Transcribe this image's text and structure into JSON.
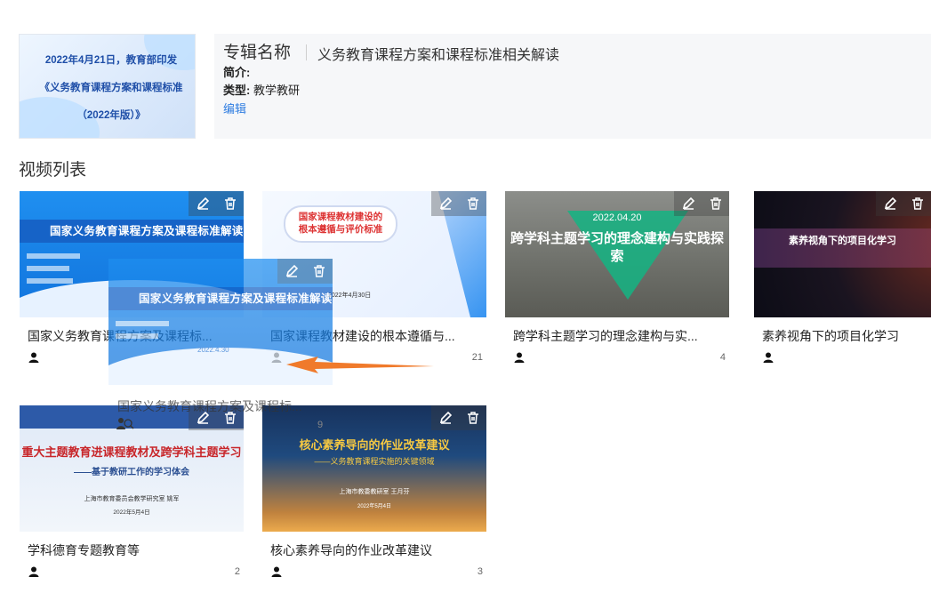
{
  "album": {
    "cover_text": "2022年4月21日，教育部印发《义务教育课程方案和课程标准（2022年版）》",
    "name_label": "专辑名称",
    "name_value": "义务教育课程方案和课程标准相关解读",
    "intro_label": "简介:",
    "type_label": "类型:",
    "type_value": "教学教研",
    "edit_label": "编辑"
  },
  "section_title": "视频列表",
  "videos": [
    {
      "title": "国家义务教育课程方案及课程标...",
      "count": "",
      "thumb_title": "国家义务教育课程方案及课程标准解读"
    },
    {
      "title": "国家课程教材建设的根本遵循与...",
      "count": "21",
      "thumb_title": "国家课程教材建设的根本遵循与评价标准",
      "thumb_date": "2022年4月30日"
    },
    {
      "title": "跨学科主题学习的理念建构与实...",
      "count": "4",
      "thumb_date": "2022.04.20",
      "thumb_title": "跨学科主题学习的理念建构与实践探索"
    },
    {
      "title": "素养视角下的项目化学习",
      "count": "",
      "thumb_title": "素养视角下的项目化学习"
    },
    {
      "title": "学科德育专题教育等",
      "count": "2",
      "thumb_title": "重大主题教育进课程教材及跨学科主题学习",
      "thumb_subtitle": "——基于教研工作的学习体会",
      "thumb_org": "上海市教育委员会教学研究室  姚军",
      "thumb_date": "2022年5月4日"
    },
    {
      "title": "核心素养导向的作业改革建议",
      "count": "3",
      "thumb_title": "核心素养导向的作业改革建议",
      "thumb_subtitle": "——义务教育课程实施的关键领域",
      "thumb_org": "上海市教委教研室  王月芬",
      "thumb_date": "2022年5月4日"
    }
  ],
  "drag_ghost": {
    "title": "国家义务教育课程方案及课程标...",
    "count": "9",
    "thumb_title": "国家义务教育课程方案及课程标准解读",
    "thumb_date": "2022.4.30"
  },
  "colors": {
    "accent": "#2f7de1",
    "drag_arrow": "#f07a2b"
  }
}
